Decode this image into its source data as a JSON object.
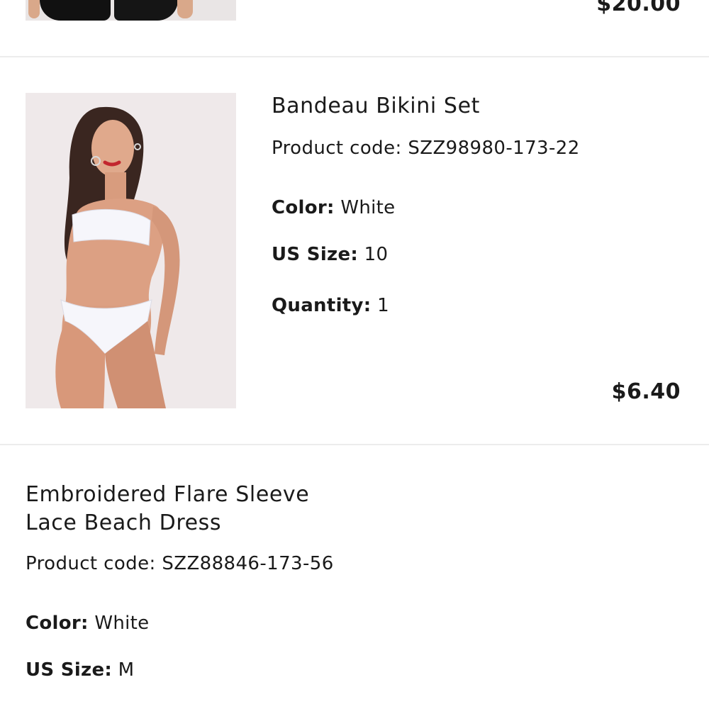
{
  "items": [
    {
      "price": "$20.00"
    },
    {
      "title": "Bandeau Bikini Set",
      "code_label": "Product code:",
      "code": "SZZ98980-173-22",
      "color_label": "Color:",
      "color": "White",
      "size_label": "US Size:",
      "size": "10",
      "quantity_label": "Quantity:",
      "quantity": "1",
      "price": "$6.40"
    },
    {
      "title_line1": "Embroidered Flare Sleeve",
      "title_line2": "Lace Beach Dress",
      "code_label": "Product code:",
      "code": "SZZ88846-173-56",
      "color_label": "Color:",
      "color": "White",
      "size_label": "US Size:",
      "size": "M"
    }
  ],
  "colors": {
    "text": "#1a1a1a",
    "divider": "#ececec",
    "thumb_bg": "#efe9ea"
  }
}
